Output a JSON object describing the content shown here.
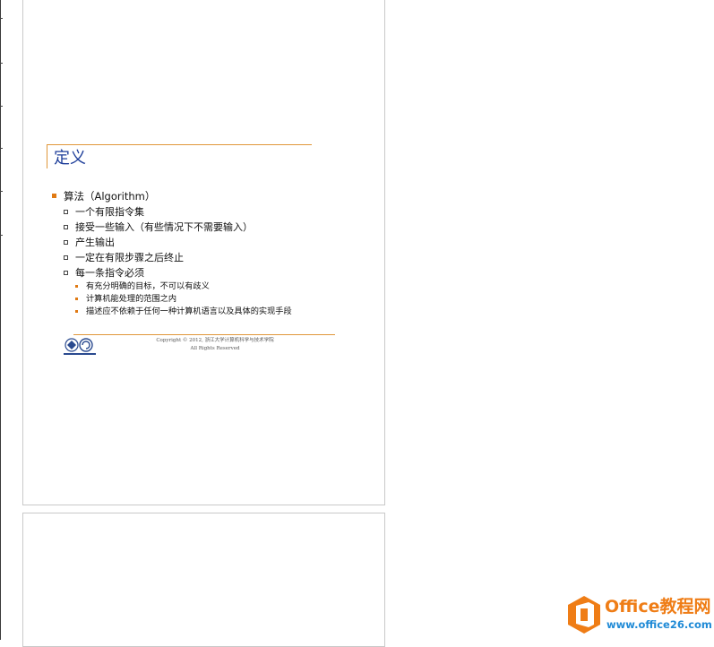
{
  "slide": {
    "title": "定义",
    "bullets": [
      {
        "text": "算法（Algorithm）",
        "children": [
          {
            "text": "一个有限指令集",
            "children": []
          },
          {
            "text": "接受一些输入（有些情况下不需要输入）",
            "children": []
          },
          {
            "text": "产生输出",
            "children": []
          },
          {
            "text": "一定在有限步骤之后终止",
            "children": []
          },
          {
            "text": "每一条指令必须",
            "children": [
              {
                "text": "有充分明确的目标，不可以有歧义"
              },
              {
                "text": "计算机能处理的范围之内"
              },
              {
                "text": "描述应不依赖于任何一种计算机语言以及具体的实现手段"
              }
            ]
          }
        ]
      }
    ],
    "footer": {
      "line1": "Copyright © 2012, 浙江大学计算机科学与技术学院",
      "line2": "All Rights Reserved"
    }
  },
  "watermark": {
    "brand": "Office教程网",
    "url": "www.office26.com"
  },
  "colors": {
    "title": "#1f3f9a",
    "accent": "#e07a14",
    "brand_orange": "#ef7d16",
    "brand_blue": "#1f8ad6"
  }
}
